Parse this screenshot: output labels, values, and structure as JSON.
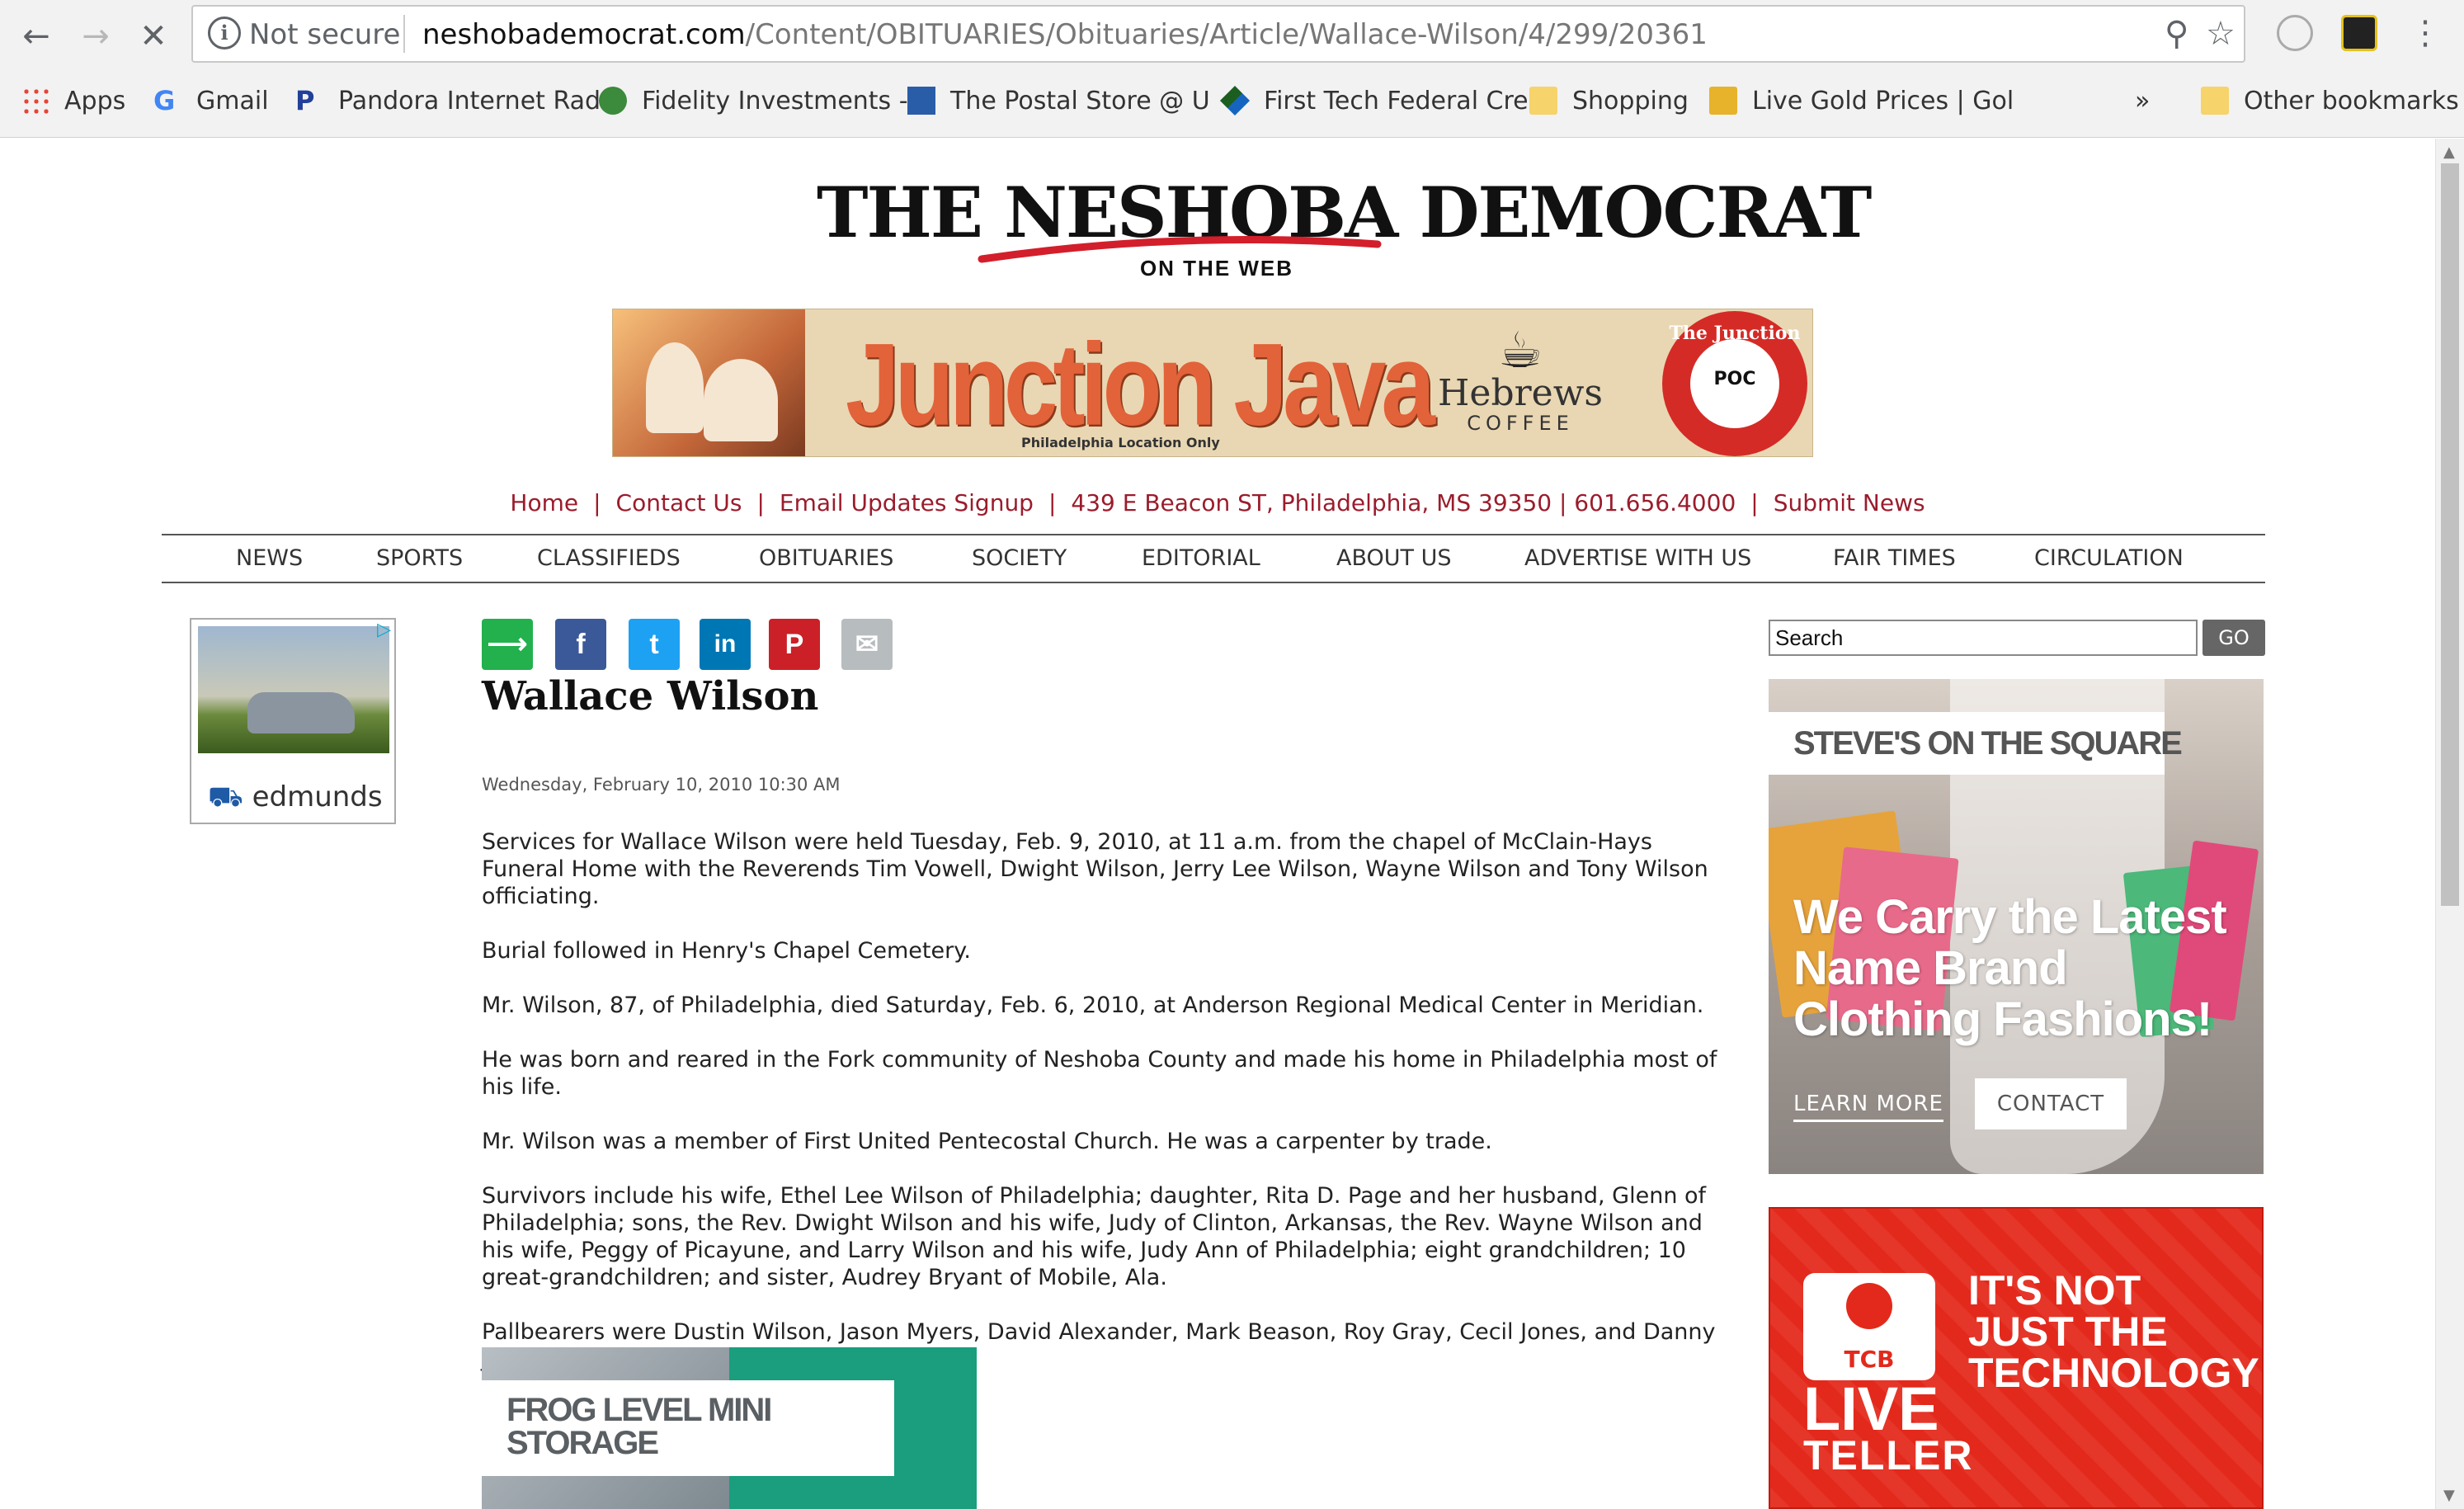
{
  "browser": {
    "security_label": "Not secure",
    "url_host": "neshobademocrat.com",
    "url_path": "/Content/OBITUARIES/Obituaries/Article/Wallace-Wilson/4/299/20361",
    "bookmarks": [
      {
        "label": "Apps",
        "icon": "apps-grid-icon"
      },
      {
        "label": "Gmail",
        "icon": "google-g-icon"
      },
      {
        "label": "Pandora Internet Rad",
        "icon": "pandora-icon"
      },
      {
        "label": "Fidelity Investments -",
        "icon": "fidelity-icon"
      },
      {
        "label": "The Postal Store @ U",
        "icon": "postal-icon"
      },
      {
        "label": "First Tech Federal Cre",
        "icon": "firsttech-icon"
      },
      {
        "label": "Shopping",
        "icon": "folder-icon"
      },
      {
        "label": "Live Gold Prices | Gol",
        "icon": "gold-icon"
      }
    ],
    "more_bookmarks": "»",
    "other_bookmarks": "Other bookmarks"
  },
  "masthead": {
    "title": "THE NESHOBA DEMOCRAT",
    "subtitle": "ON THE WEB"
  },
  "banner": {
    "title": "Junction Java",
    "location": "Philadelphia Location Only",
    "hebrews_name": "Hebrews",
    "hebrews_coffee": "COFFEE",
    "junction_top": "The Junction",
    "junction_mid": "POC"
  },
  "toplinks": {
    "items": [
      "Home",
      "Contact Us",
      "Email Updates Signup",
      "439 E Beacon ST, Philadelphia, MS 39350 | 601.656.4000",
      "Submit News"
    ]
  },
  "nav": {
    "items": [
      "NEWS",
      "SPORTS",
      "CLASSIFIEDS",
      "OBITUARIES",
      "SOCIETY",
      "EDITORIAL",
      "ABOUT US",
      "ADVERTISE WITH US",
      "FAIR TIMES",
      "CIRCULATION"
    ]
  },
  "left_ad": {
    "brand": "edmunds"
  },
  "article": {
    "title": "Wallace Wilson",
    "date": "Wednesday, February 10, 2010 10:30 AM",
    "paragraphs": [
      "Services for Wallace Wilson were held Tuesday, Feb. 9, 2010, at 11 a.m. from the chapel of McClain-Hays Funeral Home with the Reverends Tim Vowell, Dwight Wilson, Jerry Lee Wilson, Wayne Wilson and Tony Wilson officiating.",
      "Burial followed in Henry's Chapel Cemetery.",
      "Mr. Wilson, 87, of Philadelphia, died Saturday, Feb. 6, 2010, at Anderson Regional Medical Center in Meridian.",
      "He was born and reared in the Fork community of Neshoba County and made his home in Philadelphia most of his life.",
      "Mr. Wilson was a member of First United Pentecostal Church. He was a carpenter by trade.",
      "Survivors include his wife, Ethel Lee Wilson of Philadelphia; daughter, Rita D. Page and her husband, Glenn of Philadelphia; sons, the Rev. Dwight Wilson and his wife, Judy of Clinton, Arkansas, the Rev. Wayne Wilson and his wife, Peggy of Picayune, and Larry Wilson and his wife, Judy Ann of Philadelphia; eight grandchildren; 10 great-grandchildren; and sister, Audrey Bryant of Mobile, Ala.",
      "Pallbearers were Dustin Wilson, Jason Myers, David Alexander, Mark Beason, Roy Gray, Cecil Jones, and Danny Jones."
    ]
  },
  "frog_ad": {
    "line1": "FROG LEVEL MINI",
    "line2": "STORAGE"
  },
  "search": {
    "value": "Search",
    "go_label": "GO"
  },
  "steves_ad": {
    "brand": "STEVE'S ON THE SQUARE",
    "headline": "We Carry the Latest Name Brand Clothing Fashions!",
    "learn_more": "LEARN MORE",
    "contact": "CONTACT"
  },
  "tcb_ad": {
    "logo": "TCB",
    "live": "LIVE",
    "teller": "TELLER",
    "tagline": "IT'S NOT JUST THE TECHNOLOGY"
  },
  "colors": {
    "link_red": "#9b1c2c",
    "tcb_red": "#e3291c",
    "teal": "#1a9e7d"
  }
}
